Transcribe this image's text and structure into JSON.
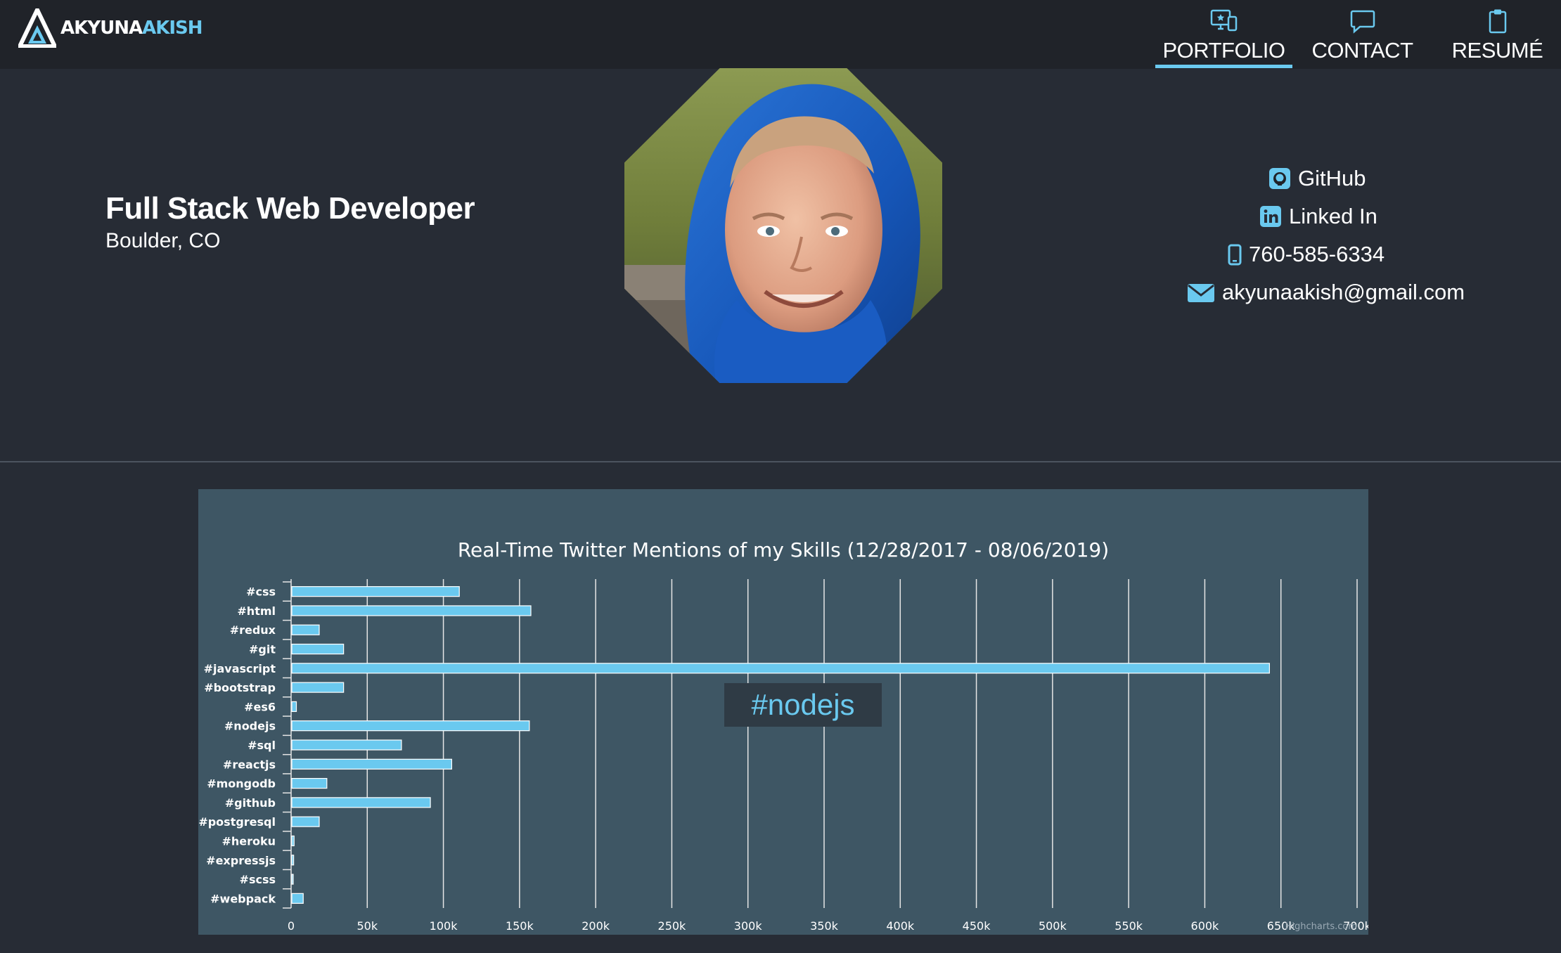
{
  "brand": {
    "prefix": "AKYUNA",
    "accent": "AKISH"
  },
  "nav": {
    "items": [
      {
        "label": "PORTFOLIO",
        "icon": "monitor-star-icon",
        "active": true
      },
      {
        "label": "CONTACT",
        "icon": "chat-bubble-icon",
        "active": false
      },
      {
        "label": "RESUMÉ",
        "icon": "clipboard-icon",
        "active": false
      }
    ]
  },
  "hero": {
    "title": "Full Stack Web Developer",
    "location": "Boulder, CO"
  },
  "contact": {
    "github": "GitHub",
    "linkedin": "Linked In",
    "phone": "760-585-6334",
    "email": "akyunaakish@gmail.com"
  },
  "colors": {
    "accent": "#6ac9ef",
    "nav_bg": "#202329",
    "page_bg": "#272c35",
    "chart_bg": "#3e5664"
  },
  "chart_data": {
    "type": "bar",
    "orientation": "horizontal",
    "title": "Real-Time Twitter Mentions of my Skills (12/28/2017 - 08/06/2019)",
    "xlabel": "",
    "ylabel": "",
    "categories": [
      "#css",
      "#html",
      "#redux",
      "#git",
      "#javascript",
      "#bootstrap",
      "#es6",
      "#nodejs",
      "#sql",
      "#reactjs",
      "#mongodb",
      "#github",
      "#postgresql",
      "#heroku",
      "#expressjs",
      "#scss",
      "#webpack"
    ],
    "values": [
      110000,
      157000,
      18000,
      34000,
      642000,
      34000,
      3000,
      156000,
      72000,
      105000,
      23000,
      91000,
      18000,
      1500,
      1200,
      500,
      7500
    ],
    "xlim": [
      0,
      700000
    ],
    "xticks": [
      "0",
      "50k",
      "100k",
      "150k",
      "200k",
      "250k",
      "300k",
      "350k",
      "400k",
      "450k",
      "500k",
      "550k",
      "600k",
      "650k",
      "700k"
    ],
    "grid": true,
    "legend": "none",
    "tooltip": "#nodejs",
    "credits": "Highcharts.com"
  }
}
